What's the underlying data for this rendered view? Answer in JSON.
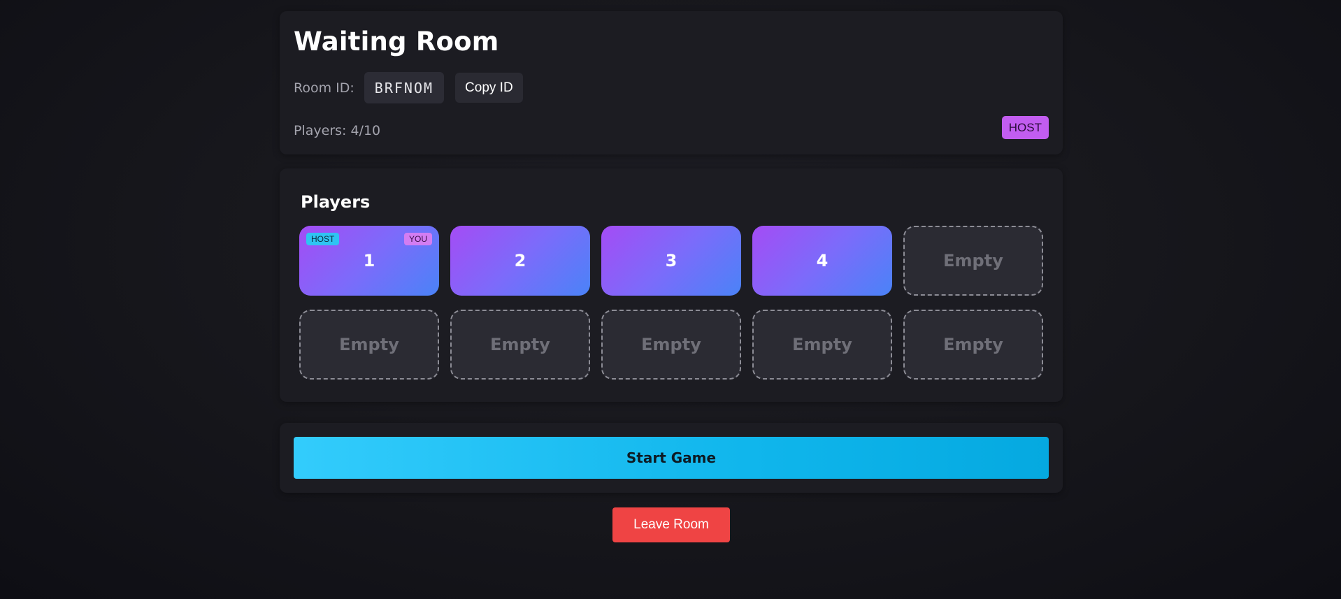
{
  "header": {
    "title": "Waiting Room",
    "room_label": "Room ID:",
    "room_id": "BRFNOM",
    "copy_label": "Copy ID",
    "players_count": "Players: 4/10",
    "role_badge": "HOST"
  },
  "players_section": {
    "title": "Players",
    "slots": [
      {
        "label": "1",
        "state": "filled",
        "host_badge": "HOST",
        "you_badge": "YOU"
      },
      {
        "label": "2",
        "state": "filled"
      },
      {
        "label": "3",
        "state": "filled"
      },
      {
        "label": "4",
        "state": "filled"
      },
      {
        "label": "Empty",
        "state": "empty"
      },
      {
        "label": "Empty",
        "state": "empty"
      },
      {
        "label": "Empty",
        "state": "empty"
      },
      {
        "label": "Empty",
        "state": "empty"
      },
      {
        "label": "Empty",
        "state": "empty"
      },
      {
        "label": "Empty",
        "state": "empty"
      }
    ]
  },
  "actions": {
    "start_label": "Start Game",
    "leave_label": "Leave Room"
  },
  "colors": {
    "accent_cyan": "#33ccfc",
    "host_purple": "#c25df0",
    "danger_red": "#ef4444",
    "player_gradient_start": "#a44cf5",
    "player_gradient_end": "#4a83f8"
  }
}
